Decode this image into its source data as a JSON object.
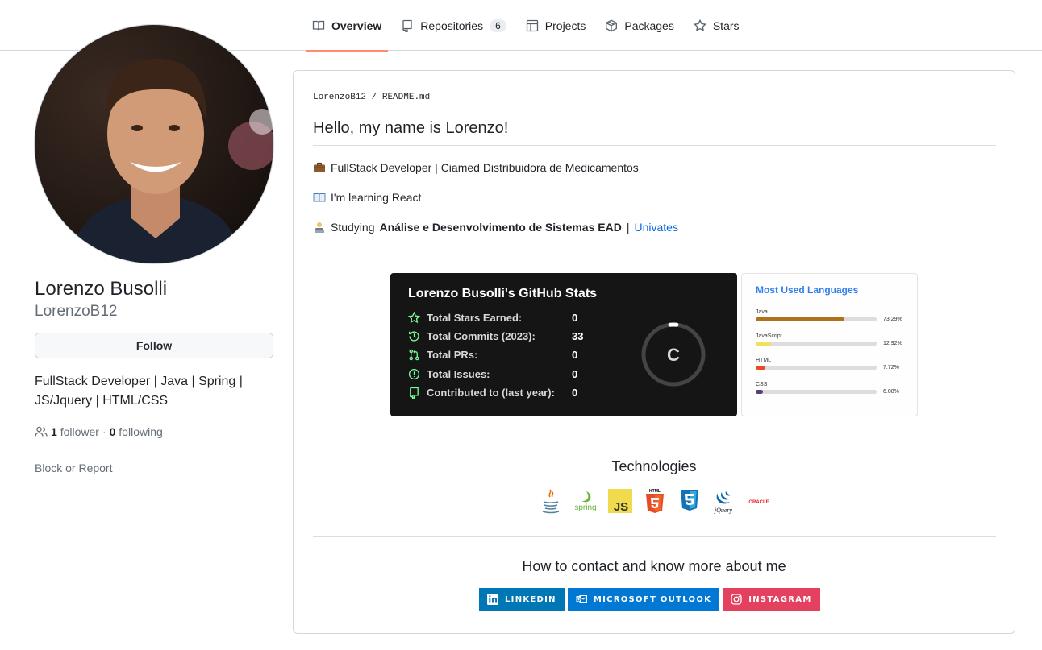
{
  "nav": {
    "tabs": [
      {
        "label": "Overview",
        "icon": "book-icon",
        "active": true
      },
      {
        "label": "Repositories",
        "icon": "repo-icon",
        "count": "6"
      },
      {
        "label": "Projects",
        "icon": "table-icon"
      },
      {
        "label": "Packages",
        "icon": "package-icon"
      },
      {
        "label": "Stars",
        "icon": "star-icon"
      }
    ]
  },
  "profile": {
    "fullname": "Lorenzo Busolli",
    "username": "LorenzoB12",
    "follow_label": "Follow",
    "bio": "FullStack Developer | Java | Spring | JS/Jquery | HTML/CSS",
    "followers_count": "1",
    "followers_label": "follower",
    "separator": "·",
    "following_count": "0",
    "following_label": "following",
    "block_label": "Block or Report"
  },
  "readme": {
    "path_user": "LorenzoB12",
    "path_sep": "/",
    "path_file": "README.md",
    "heading": "Hello, my name is Lorenzo!",
    "line1": "FullStack Developer | Ciamed Distribuidora de Medicamentos",
    "line2": "I'm learning React",
    "line3_prefix": "Studying",
    "line3_bold": "Análise e Desenvolvimento de Sistemas EAD",
    "line3_sep": "|",
    "line3_link": "Univates"
  },
  "stats_card": {
    "title": "Lorenzo Busolli's GitHub Stats",
    "rows": [
      {
        "label": "Total Stars Earned:",
        "value": "0",
        "icon": "star-icon"
      },
      {
        "label": "Total Commits (2023):",
        "value": "33",
        "icon": "history-icon"
      },
      {
        "label": "Total PRs:",
        "value": "0",
        "icon": "pull-request-icon"
      },
      {
        "label": "Total Issues:",
        "value": "0",
        "icon": "issue-icon"
      },
      {
        "label": "Contributed to (last year):",
        "value": "0",
        "icon": "repo-icon"
      }
    ],
    "rank": "C",
    "colors": {
      "bg": "#151515",
      "icon": "#79ff97",
      "ring": "#444444",
      "ring_progress": "#ffffff"
    }
  },
  "languages_card": {
    "title": "Most Used Languages",
    "langs": [
      {
        "name": "Java",
        "percent": "73.29%",
        "value": 73.29,
        "color": "#b07219"
      },
      {
        "name": "JavaScript",
        "percent": "12.92%",
        "value": 12.92,
        "color": "#f1e05a"
      },
      {
        "name": "HTML",
        "percent": "7.72%",
        "value": 7.72,
        "color": "#e34c26"
      },
      {
        "name": "CSS",
        "percent": "6.08%",
        "value": 6.08,
        "color": "#563d7c"
      }
    ]
  },
  "technologies": {
    "title": "Technologies",
    "items": [
      "java-icon",
      "spring-icon",
      "javascript-icon",
      "html5-icon",
      "css3-icon",
      "jquery-icon",
      "oracle-icon"
    ],
    "spring_text": "spring",
    "js_text": "JS",
    "html_text": "HTML",
    "jquery_text": "jQuery",
    "oracle_text": "ORACLE"
  },
  "contact": {
    "title": "How to contact and know more about me",
    "badges": [
      {
        "label": "LINKEDIN",
        "color": "#0077b5",
        "icon": "linkedin-icon"
      },
      {
        "label": "MICROSOFT OUTLOOK",
        "color": "#0078d4",
        "icon": "outlook-icon"
      },
      {
        "label": "INSTAGRAM",
        "color": "#e4405f",
        "icon": "instagram-icon"
      }
    ]
  }
}
